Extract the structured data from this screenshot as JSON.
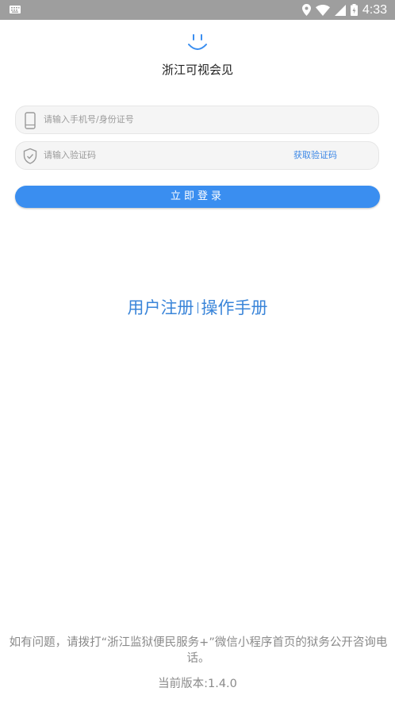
{
  "status_bar": {
    "time": "4:33"
  },
  "app": {
    "title": "浙江可视会见"
  },
  "form": {
    "phone_placeholder": "请输入手机号/身份证号",
    "code_placeholder": "请输入验证码",
    "get_code_label": "获取验证码",
    "login_label": "立即登录"
  },
  "links": {
    "register": "用户注册",
    "manual": "操作手册"
  },
  "footer": {
    "help_text": "如有问题，请拨打“浙江监狱便民服务+”微信小程序首页的狱务公开咨询电话。",
    "version_text": "当前版本:1.4.0"
  },
  "colors": {
    "accent": "#3a8ef0",
    "link": "#3a85d9",
    "status_bar": "#9e9e9e"
  }
}
